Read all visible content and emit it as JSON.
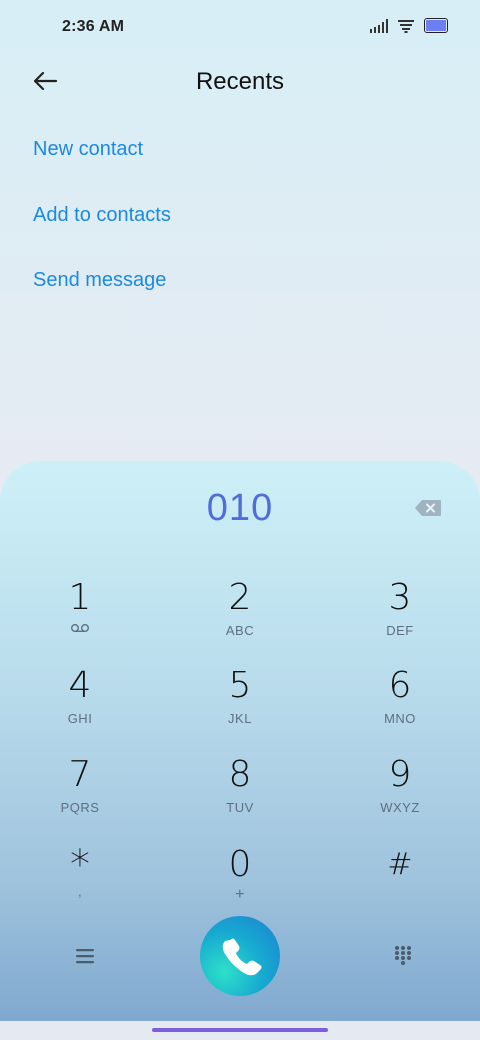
{
  "status_bar": {
    "time": "2:36 AM"
  },
  "header": {
    "title": "Recents"
  },
  "actions": {
    "new_contact": "New contact",
    "add_to_contacts": "Add to contacts",
    "send_message": "Send message"
  },
  "dialer": {
    "number": "010",
    "keys": [
      {
        "digit": "1",
        "letters": ""
      },
      {
        "digit": "2",
        "letters": "ABC"
      },
      {
        "digit": "3",
        "letters": "DEF"
      },
      {
        "digit": "4",
        "letters": "GHI"
      },
      {
        "digit": "5",
        "letters": "JKL"
      },
      {
        "digit": "6",
        "letters": "MNO"
      },
      {
        "digit": "7",
        "letters": "PQRS"
      },
      {
        "digit": "8",
        "letters": "TUV"
      },
      {
        "digit": "9",
        "letters": "WXYZ"
      },
      {
        "digit": "*",
        "letters": ","
      },
      {
        "digit": "0",
        "letters": "+"
      },
      {
        "digit": "#",
        "letters": ""
      }
    ]
  },
  "icons": {
    "back": "back-arrow-icon",
    "backspace": "backspace-icon",
    "voicemail": "voicemail-icon",
    "menu": "menu-icon",
    "call": "phone-icon",
    "dialpad": "dialpad-icon"
  },
  "colors": {
    "link": "#1a8ae0",
    "number": "#4f6ed8",
    "call_button": "#17a9d1"
  }
}
